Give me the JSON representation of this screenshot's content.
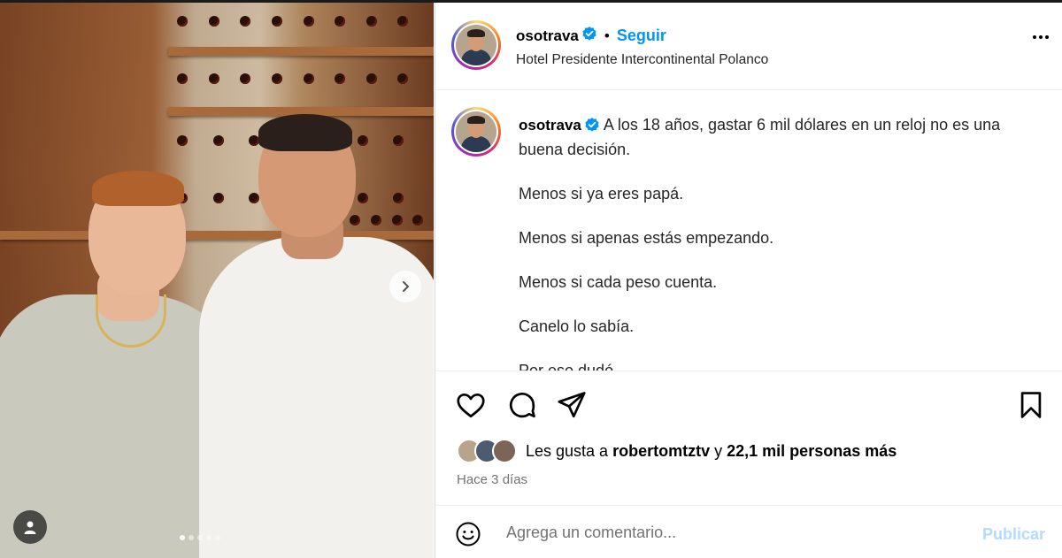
{
  "post": {
    "username": "osotrava",
    "follow_label": "Seguir",
    "separator": "•",
    "location": "Hotel Presidente Intercontinental Polanco"
  },
  "caption": {
    "username": "osotrava",
    "lines": [
      "A los 18 años, gastar 6 mil dólares en un reloj no es una buena decisión.",
      "Menos si ya eres papá.",
      "Menos si apenas estás empezando.",
      "Menos si cada peso cuenta.",
      "Canelo lo sabía.",
      "Por eso dudó."
    ]
  },
  "likes": {
    "prefix": "Les gusta a",
    "liker": "robertomtztv",
    "connector": "y",
    "others": "22,1 mil personas más"
  },
  "time_ago": "Hace 3 días",
  "comment": {
    "placeholder": "Agrega un comentario...",
    "publish_label": "Publicar"
  },
  "carousel": {
    "total": 5,
    "current": 1
  },
  "icons": {
    "verified": "verified-badge-icon",
    "like": "heart-icon",
    "comment": "comment-bubble-icon",
    "share": "paper-plane-icon",
    "save": "bookmark-icon",
    "emoji": "emoji-icon",
    "more": "more-options-icon",
    "next": "chevron-right-icon",
    "tags": "user-tag-icon"
  },
  "colors": {
    "accent": "#0095f6",
    "verified": "#0095f6",
    "publish_disabled": "#b3dbff"
  }
}
